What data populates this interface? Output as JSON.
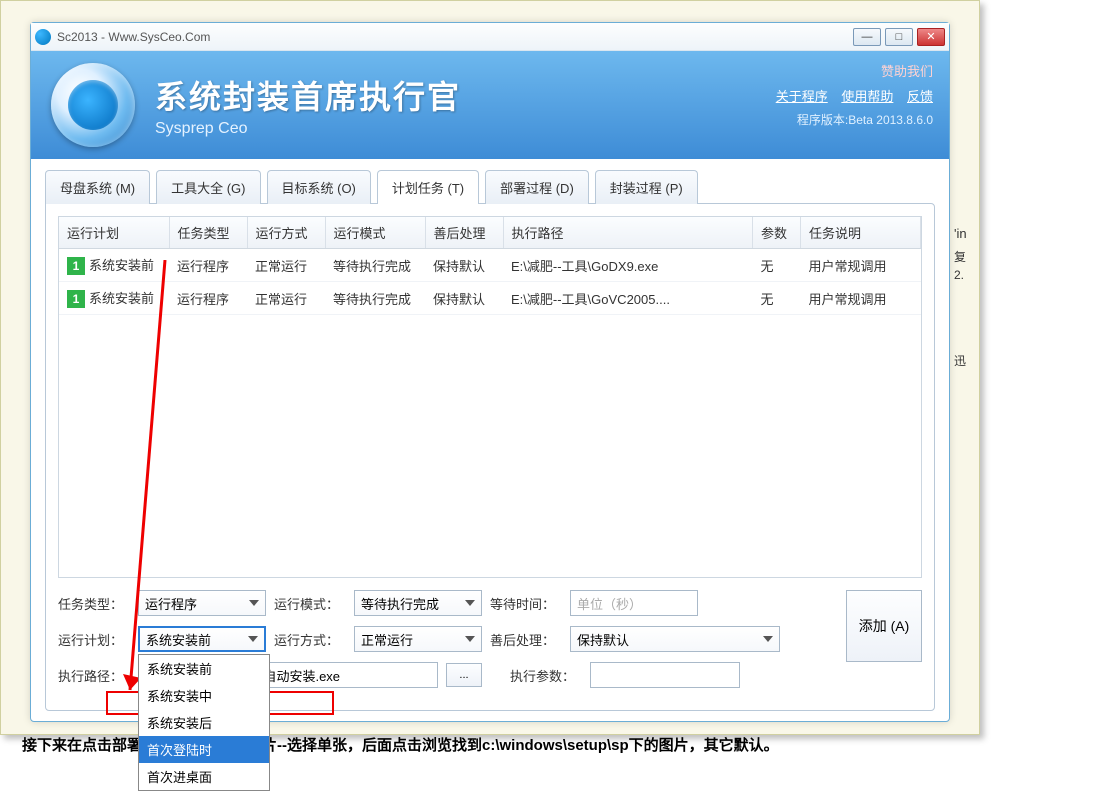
{
  "titlebar": {
    "title": "Sc2013 - Www.SysCeo.Com"
  },
  "winbtns": {
    "min": "—",
    "max": "□",
    "close": "✕"
  },
  "header": {
    "title": "系统封装首席执行官",
    "subtitle": "Sysprep  Ceo",
    "sponsor": "赞助我们",
    "link_about": "关于程序",
    "link_help": "使用帮助",
    "link_feedback": "反馈",
    "version": "程序版本:Beta 2013.8.6.0"
  },
  "tabs": {
    "t0": "母盘系统 (M)",
    "t1": "工具大全 (G)",
    "t2": "目标系统 (O)",
    "t3": "计划任务 (T)",
    "t4": "部署过程 (D)",
    "t5": "封装过程 (P)"
  },
  "columns": {
    "c0": "运行计划",
    "c1": "任务类型",
    "c2": "运行方式",
    "c3": "运行模式",
    "c4": "善后处理",
    "c5": "执行路径",
    "c6": "参数",
    "c7": "任务说明"
  },
  "rows": [
    {
      "num": "1",
      "plan": "系统安装前",
      "type": "运行程序",
      "way": "正常运行",
      "mode": "等待执行完成",
      "post": "保持默认",
      "path": "E:\\减肥--工具\\GoDX9.exe",
      "arg": "无",
      "desc": "用户常规调用"
    },
    {
      "num": "1",
      "plan": "系统安装前",
      "type": "运行程序",
      "way": "正常运行",
      "mode": "等待执行完成",
      "post": "保持默认",
      "path": "E:\\减肥--工具\\GoVC2005....",
      "arg": "无",
      "desc": "用户常规调用"
    }
  ],
  "form": {
    "lbl_tasktype": "任务类型：",
    "val_tasktype": "运行程序",
    "lbl_runmode": "运行模式：",
    "val_runmode": "等待执行完成",
    "lbl_waittime": "等待时间：",
    "val_waittime": "",
    "unit": "单位（秒）",
    "lbl_runplan": "运行计划：",
    "val_runplan": "系统安装前",
    "lbl_runway": "运行方式：",
    "val_runway": "正常运行",
    "lbl_post": "善后处理：",
    "val_post": "保持默认",
    "lbl_path": "执行路径：",
    "val_path": "E:\\减肥--工具\\QQ5.1自动安装.exe",
    "lbl_args": "执行参数：",
    "val_args": "",
    "btn_add": "添加 (A)",
    "btn_browse": "..."
  },
  "dropdown": {
    "o0": "系统安装前",
    "o1": "系统安装中",
    "o2": "系统安装后",
    "o3": "首次登陆时",
    "o4": "首次进桌面"
  },
  "bottom_text": "接下来在点击部署过程：部署背景图片--选择单张，后面点击浏览找到c:\\windows\\setup\\sp下的图片，其它默认。",
  "right": {
    "r1": "'in",
    "r2": "复",
    "r3": "2.",
    "r4": "迅"
  }
}
